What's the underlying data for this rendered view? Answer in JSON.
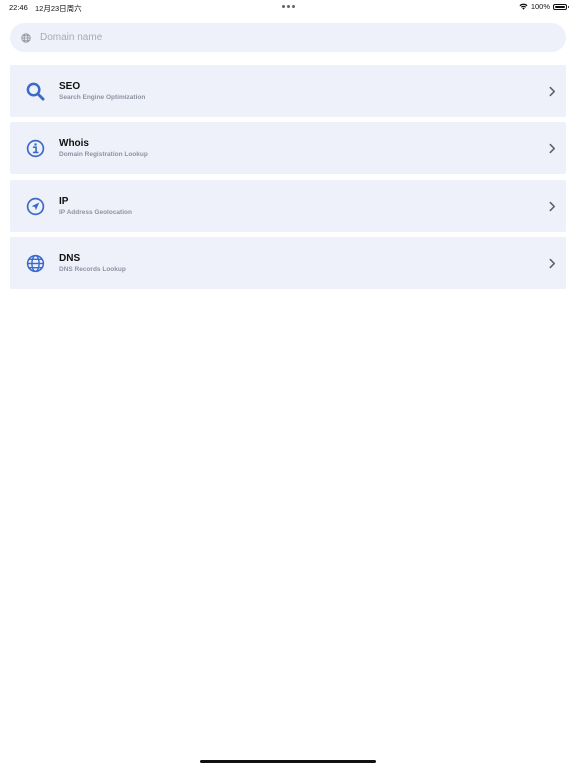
{
  "status_bar": {
    "time": "22:46",
    "date": "12月23日周六",
    "battery": "100%"
  },
  "search": {
    "placeholder": "Domain name",
    "value": "",
    "icon": "globe-icon"
  },
  "tools": [
    {
      "title": "SEO",
      "subtitle": "Search Engine Optimization",
      "icon": "magnifying-glass-icon"
    },
    {
      "title": "Whois",
      "subtitle": "Domain Registration Lookup",
      "icon": "info-circle-icon"
    },
    {
      "title": "IP",
      "subtitle": "IP Address Geolocation",
      "icon": "location-arrow-icon"
    },
    {
      "title": "DNS",
      "subtitle": "DNS Records Lookup",
      "icon": "globe-icon"
    }
  ],
  "colors": {
    "accent": "#3a6bc9",
    "card_background": "#eef0fa",
    "subtitle": "#8f93a1",
    "placeholder": "#a8aabb"
  }
}
